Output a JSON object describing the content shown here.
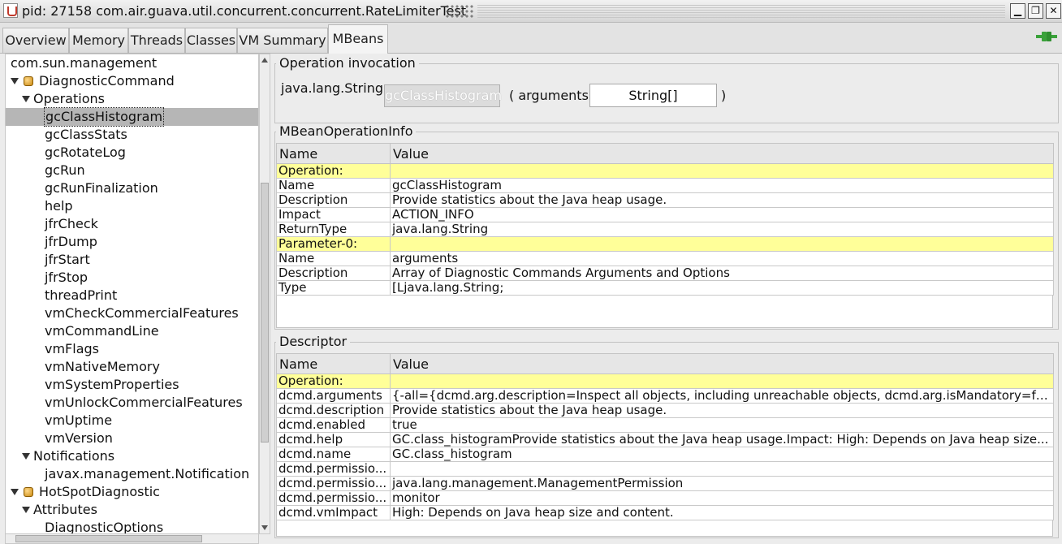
{
  "window": {
    "title": "pid: 27158 com.air.guava.util.concurrent.concurrent.RateLimiterTest",
    "minimize_label": "▁",
    "maximize_label": "❐",
    "close_label": "✕"
  },
  "tabs": [
    {
      "label": "Overview"
    },
    {
      "label": "Memory"
    },
    {
      "label": "Threads"
    },
    {
      "label": "Classes"
    },
    {
      "label": "VM Summary"
    },
    {
      "label": "MBeans",
      "active": true
    }
  ],
  "tree": {
    "items": [
      {
        "label": "com.sun.management",
        "level": 0
      },
      {
        "label": "DiagnosticCommand",
        "level": 1,
        "bean": true,
        "expanded": true
      },
      {
        "label": "Operations",
        "level": 2,
        "expanded": true
      },
      {
        "label": "gcClassHistogram",
        "level": 3,
        "selected": true
      },
      {
        "label": "gcClassStats",
        "level": 3
      },
      {
        "label": "gcRotateLog",
        "level": 3
      },
      {
        "label": "gcRun",
        "level": 3
      },
      {
        "label": "gcRunFinalization",
        "level": 3
      },
      {
        "label": "help",
        "level": 3
      },
      {
        "label": "jfrCheck",
        "level": 3
      },
      {
        "label": "jfrDump",
        "level": 3
      },
      {
        "label": "jfrStart",
        "level": 3
      },
      {
        "label": "jfrStop",
        "level": 3
      },
      {
        "label": "threadPrint",
        "level": 3
      },
      {
        "label": "vmCheckCommercialFeatures",
        "level": 3
      },
      {
        "label": "vmCommandLine",
        "level": 3
      },
      {
        "label": "vmFlags",
        "level": 3
      },
      {
        "label": "vmNativeMemory",
        "level": 3
      },
      {
        "label": "vmSystemProperties",
        "level": 3
      },
      {
        "label": "vmUnlockCommercialFeatures",
        "level": 3
      },
      {
        "label": "vmUptime",
        "level": 3
      },
      {
        "label": "vmVersion",
        "level": 3
      },
      {
        "label": "Notifications",
        "level": 2,
        "expanded": true
      },
      {
        "label": "javax.management.Notification",
        "level": 3
      },
      {
        "label": "HotSpotDiagnostic",
        "level": 1,
        "bean": true,
        "expanded": true
      },
      {
        "label": "Attributes",
        "level": 2,
        "expanded": true
      },
      {
        "label": "DiagnosticOptions",
        "level": 3
      }
    ]
  },
  "operation_invocation": {
    "title": "Operation invocation",
    "return_type": "java.lang.String",
    "button_label": "gcClassHistogram",
    "paren_open": "( arguments",
    "argument_value": "String[]",
    "paren_close": ")"
  },
  "operation_info": {
    "title": "MBeanOperationInfo",
    "headers": {
      "name": "Name",
      "value": "Value"
    },
    "rows": [
      {
        "name": "Operation:",
        "value": "",
        "section": true
      },
      {
        "name": "Name",
        "value": "gcClassHistogram"
      },
      {
        "name": "Description",
        "value": "Provide statistics about the Java heap usage."
      },
      {
        "name": "Impact",
        "value": "ACTION_INFO"
      },
      {
        "name": "ReturnType",
        "value": "java.lang.String"
      },
      {
        "name": "Parameter-0:",
        "value": "",
        "section": true
      },
      {
        "name": "Name",
        "value": "arguments"
      },
      {
        "name": "Description",
        "value": "Array of Diagnostic Commands Arguments and Options"
      },
      {
        "name": "Type",
        "value": "[Ljava.lang.String;"
      }
    ]
  },
  "descriptor": {
    "title": "Descriptor",
    "headers": {
      "name": "Name",
      "value": "Value"
    },
    "rows": [
      {
        "name": "Operation:",
        "value": "",
        "section": true
      },
      {
        "name": "dcmd.arguments",
        "value": "{-all={dcmd.arg.description=Inspect all objects, including unreachable objects, dcmd.arg.isMandatory=fa..."
      },
      {
        "name": "dcmd.description",
        "value": "Provide statistics about the Java heap usage."
      },
      {
        "name": "dcmd.enabled",
        "value": "true"
      },
      {
        "name": "dcmd.help",
        "value": "GC.class_histogramProvide statistics about the Java heap usage.Impact: High: Depends on Java heap size..."
      },
      {
        "name": "dcmd.name",
        "value": "GC.class_histogram"
      },
      {
        "name": "dcmd.permissio...",
        "value": ""
      },
      {
        "name": "dcmd.permissio...",
        "value": "java.lang.management.ManagementPermission"
      },
      {
        "name": "dcmd.permissio...",
        "value": "monitor"
      },
      {
        "name": "dcmd.vmImpact",
        "value": "High: Depends on Java heap size and content."
      }
    ]
  },
  "colors": {
    "section_highlight": "#ffff99",
    "selected_row": "#b6b6b6",
    "connect_icon": "#3aa23a"
  },
  "icons": {
    "app": "java-cup-icon",
    "bean": "bean-icon",
    "connect": "connection-plug-icon"
  }
}
